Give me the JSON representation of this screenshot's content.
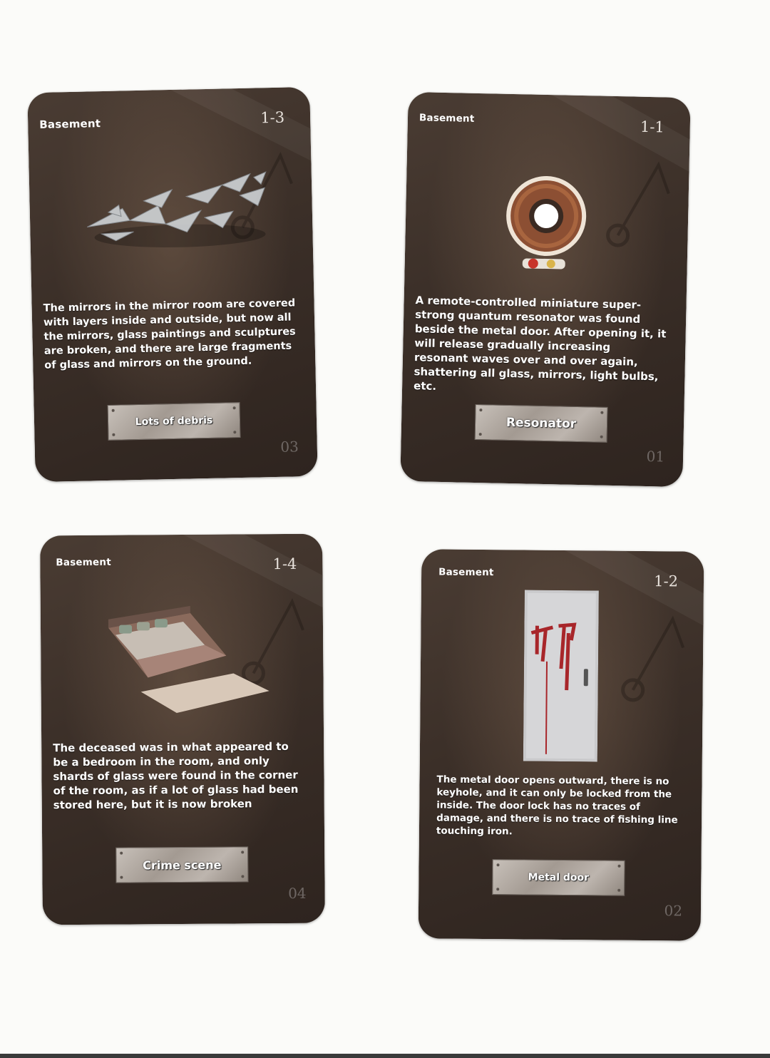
{
  "cards": [
    {
      "location": "Basement",
      "code": "1-3",
      "description": "The mirrors in the mirror room are covered with layers inside and outside, but now all the mirrors, glass paintings and sculptures are broken, and there are large fragments of glass and mirrors on the ground.",
      "label": "Lots of debris",
      "number": "03",
      "icon": "broken-glass-icon"
    },
    {
      "location": "Basement",
      "code": "1-1",
      "description": "A remote-controlled miniature super-strong quantum resonator was found beside the metal door. After opening it, it will release gradually increasing resonant waves over and over again, shattering all glass, mirrors, light bulbs, etc.",
      "label": "Resonator",
      "number": "01",
      "icon": "resonator-coil-icon"
    },
    {
      "location": "Basement",
      "code": "1-4",
      "description": "The deceased was in what appeared to be a bedroom in the room, and only shards of glass were found in the corner of the room, as if a lot of glass had been stored here, but it is now broken",
      "label": "Crime scene",
      "number": "04",
      "icon": "bed-icon"
    },
    {
      "location": "Basement",
      "code": "1-2",
      "description": "The metal door opens outward, there is no keyhole, and it can only be locked from the inside. The door lock has no traces of damage, and there is no trace of fishing line touching iron.",
      "label": "Metal door",
      "number": "02",
      "icon": "metal-door-icon"
    }
  ]
}
